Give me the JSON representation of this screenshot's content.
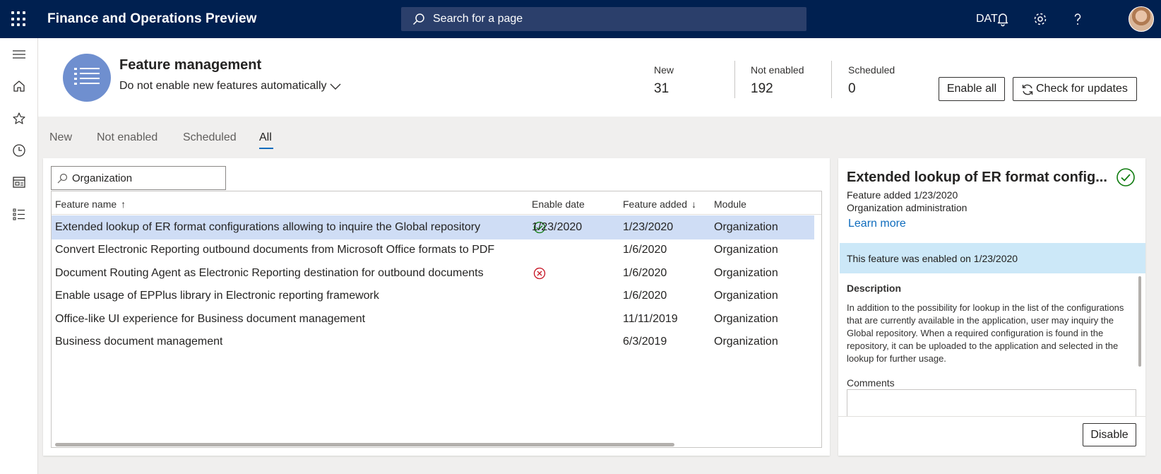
{
  "topbar": {
    "app_title": "Finance and Operations Preview",
    "search_placeholder": "Search for a page",
    "company": "DAT"
  },
  "header": {
    "title": "Feature management",
    "auto_enable_option": "Do not enable new features automatically",
    "stats": [
      {
        "label": "New",
        "value": "31"
      },
      {
        "label": "Not enabled",
        "value": "192"
      },
      {
        "label": "Scheduled",
        "value": "0"
      }
    ],
    "enable_all_label": "Enable all",
    "check_updates_label": "Check for updates"
  },
  "tabs": [
    {
      "label": "New",
      "active": false
    },
    {
      "label": "Not enabled",
      "active": false
    },
    {
      "label": "Scheduled",
      "active": false
    },
    {
      "label": "All",
      "active": true
    }
  ],
  "grid": {
    "filter_value": "Organization",
    "columns": {
      "feature_name": "Feature name",
      "enable_date": "Enable date",
      "feature_added": "Feature added",
      "module": "Module"
    },
    "rows": [
      {
        "name": "Extended lookup of ER format configurations allowing to inquire the Global repository",
        "status": "enabled",
        "enable_date": "1/23/2020",
        "added": "1/23/2020",
        "module": "Organization"
      },
      {
        "name": "Convert Electronic Reporting outbound documents from Microsoft Office formats to PDF",
        "status": "",
        "enable_date": "",
        "added": "1/6/2020",
        "module": "Organization"
      },
      {
        "name": "Document Routing Agent as Electronic Reporting destination for outbound documents",
        "status": "blocked",
        "enable_date": "",
        "added": "1/6/2020",
        "module": "Organization"
      },
      {
        "name": "Enable usage of EPPlus library in Electronic reporting framework",
        "status": "",
        "enable_date": "",
        "added": "1/6/2020",
        "module": "Organization"
      },
      {
        "name": "Office-like UI experience for Business document management",
        "status": "",
        "enable_date": "",
        "added": "11/11/2019",
        "module": "Organization"
      },
      {
        "name": "Business document management",
        "status": "",
        "enable_date": "",
        "added": "6/3/2019",
        "module": "Organization"
      }
    ]
  },
  "detail": {
    "title": "Extended lookup of ER format configurations allowing to inquire the Global repository",
    "feature_added": "Feature added 1/23/2020",
    "module": "Organization administration",
    "learn_more": "Learn more",
    "banner": "This feature was enabled on 1/23/2020",
    "description_label": "Description",
    "description": "In addition to the possibility for lookup in the list of the configurations that are currently available in the application, user may inquiry the Global repository. When a required configuration is found in the repository, it can be uploaded to the application and selected in the lookup for further usage.",
    "comments_label": "Comments",
    "disable_label": "Disable"
  },
  "colors": {
    "topbar": "#002050",
    "accent": "#0f6cbd",
    "enabled_green": "#107c10",
    "blocked_red": "#c50f1f",
    "selected_row": "#cfddf5",
    "banner": "#cce8f8"
  }
}
